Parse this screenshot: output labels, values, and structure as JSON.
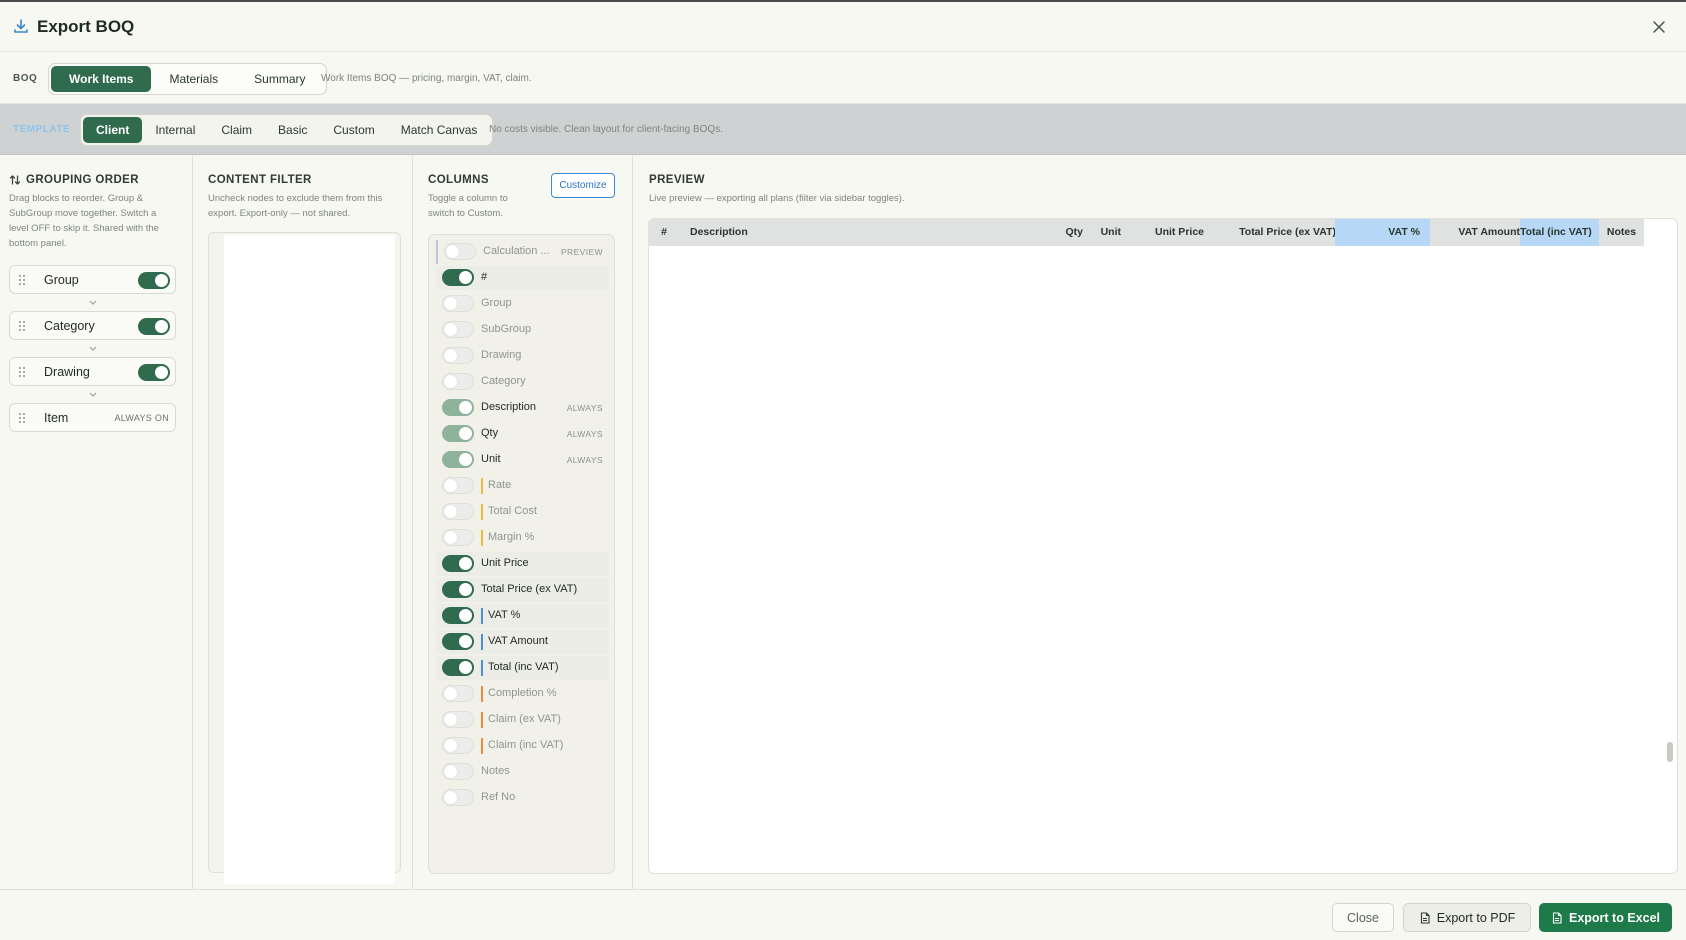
{
  "header": {
    "title": "Export BOQ"
  },
  "boq": {
    "label": "BOQ",
    "tabs": [
      "Work Items",
      "Materials",
      "Summary"
    ],
    "active": 0,
    "description": "Work Items BOQ — pricing, margin, VAT, claim."
  },
  "template": {
    "label": "TEMPLATE",
    "tabs": [
      "Client",
      "Internal",
      "Claim",
      "Basic",
      "Custom",
      "Match Canvas"
    ],
    "active": 0,
    "description": "No costs visible. Clean layout for client-facing BOQs."
  },
  "grouping": {
    "title": "GROUPING ORDER",
    "subtitle": [
      "Drag blocks to reorder. Group &",
      "SubGroup move together. Switch a",
      "level OFF to skip it. Shared with the",
      "bottom panel."
    ],
    "items": [
      {
        "label": "Group",
        "on": true
      },
      {
        "label": "Category",
        "on": true
      },
      {
        "label": "Drawing",
        "on": true
      },
      {
        "label": "Item",
        "always": "ALWAYS ON"
      }
    ]
  },
  "filter": {
    "title": "CONTENT FILTER",
    "subtitle": [
      "Uncheck nodes to exclude them from this",
      "export. Export-only — not shared."
    ]
  },
  "columns": {
    "title": "COLUMNS",
    "subtitle": [
      "Toggle a column to",
      "switch to Custom."
    ],
    "customize_label": "Customize",
    "rows": [
      {
        "label": "Calculation ...",
        "state": "off",
        "badge": "PREVIEW",
        "calc": true
      },
      {
        "label": "#",
        "state": "on"
      },
      {
        "label": "Group",
        "state": "off"
      },
      {
        "label": "SubGroup",
        "state": "off"
      },
      {
        "label": "Drawing",
        "state": "off"
      },
      {
        "label": "Category",
        "state": "off"
      },
      {
        "label": "Description",
        "state": "fixed",
        "badge": "ALWAYS"
      },
      {
        "label": "Qty",
        "state": "fixed",
        "badge": "ALWAYS"
      },
      {
        "label": "Unit",
        "state": "fixed",
        "badge": "ALWAYS"
      },
      {
        "label": "Rate",
        "state": "off",
        "bar": "#f0b93a"
      },
      {
        "label": "Total Cost",
        "state": "off",
        "bar": "#f0b93a"
      },
      {
        "label": "Margin %",
        "state": "off",
        "bar": "#f0b93a"
      },
      {
        "label": "Unit Price",
        "state": "on"
      },
      {
        "label": "Total Price (ex VAT)",
        "state": "on"
      },
      {
        "label": "VAT %",
        "state": "on",
        "bar": "#4a90d9"
      },
      {
        "label": "VAT Amount",
        "state": "on",
        "bar": "#4a90d9"
      },
      {
        "label": "Total (inc VAT)",
        "state": "on",
        "bar": "#4a90d9"
      },
      {
        "label": "Completion %",
        "state": "off",
        "bar": "#ee8a3a"
      },
      {
        "label": "Claim (ex VAT)",
        "state": "off",
        "bar": "#ee8a3a"
      },
      {
        "label": "Claim (inc VAT)",
        "state": "off",
        "bar": "#ee8a3a"
      },
      {
        "label": "Notes",
        "state": "off"
      },
      {
        "label": "Ref No",
        "state": "off"
      }
    ]
  },
  "preview": {
    "title": "PREVIEW",
    "subtitle": "Live preview — exporting all plans (filter via sidebar toggles).",
    "headers": [
      "#",
      "Description",
      "Qty",
      "Unit",
      "Unit Price",
      "Total Price (ex VAT)",
      "VAT %",
      "VAT Amount",
      "Total (inc VAT)",
      "Notes"
    ]
  },
  "footer": {
    "close_label": "Close",
    "pdf_label": "Export to PDF",
    "excel_label": "Export to Excel"
  },
  "colors": {
    "accent": "#2f6b4c",
    "excel": "#1f7a4a",
    "vat_header": "#b6d8f6"
  }
}
